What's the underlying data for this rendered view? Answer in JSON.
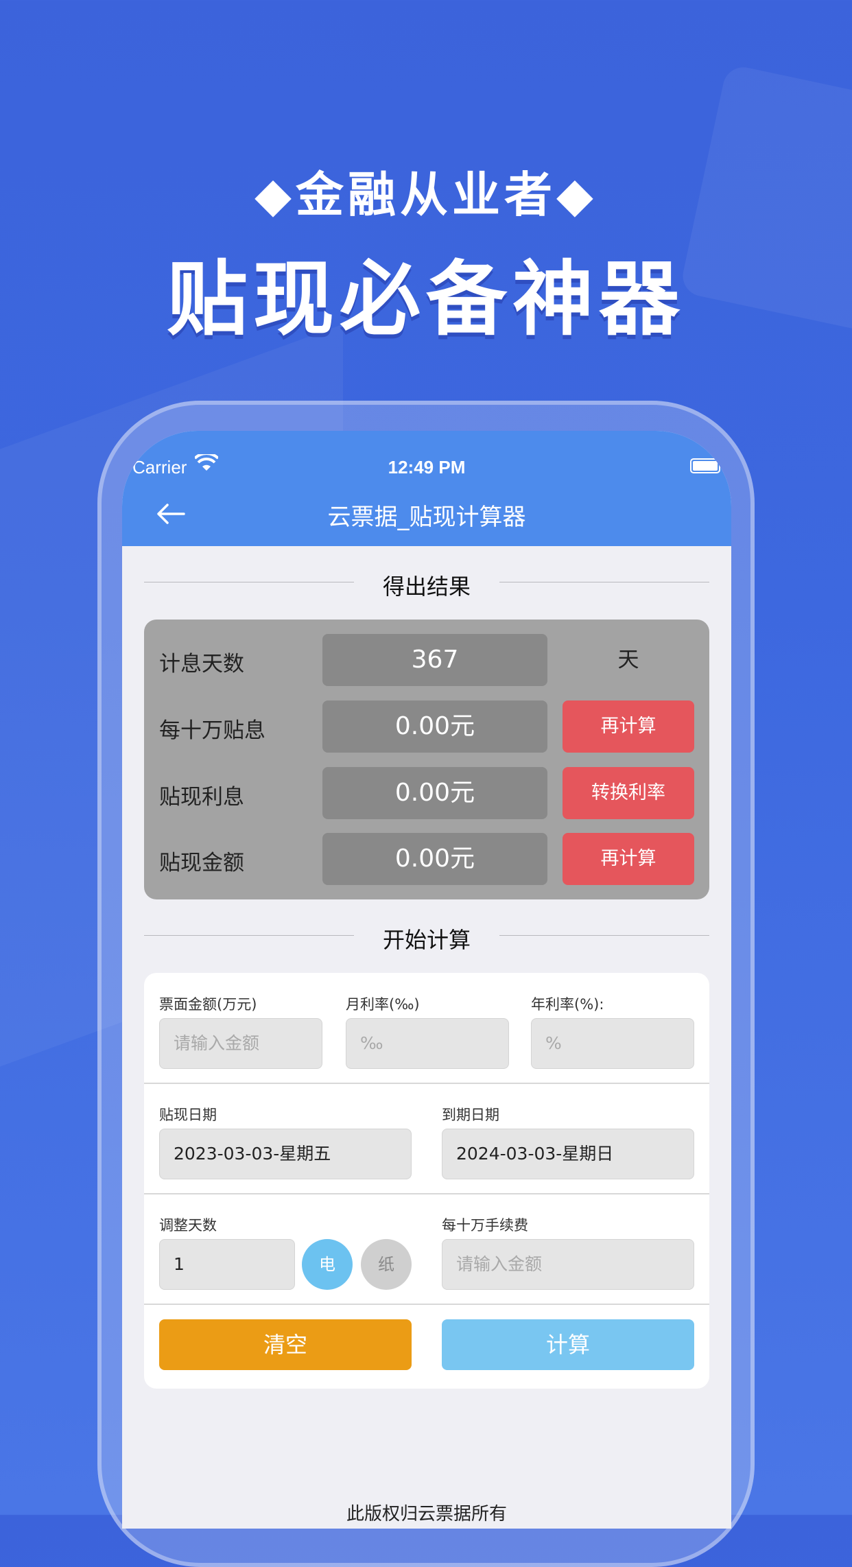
{
  "promo": {
    "subtitle": "◆金融从业者◆",
    "title": "贴现必备神器"
  },
  "status_bar": {
    "carrier": "Carrier",
    "time": "12:49 PM"
  },
  "nav": {
    "title": "云票据_贴现计算器"
  },
  "results": {
    "section_title": "得出结果",
    "rows": [
      {
        "label": "计息天数",
        "value": "367",
        "unit": "天"
      },
      {
        "label": "每十万贴息",
        "value": "0.00元",
        "button": "再计算"
      },
      {
        "label": "贴现利息",
        "value": "0.00元",
        "button": "转换利率"
      },
      {
        "label": "贴现金额",
        "value": "0.00元",
        "button": "再计算"
      }
    ]
  },
  "calc": {
    "section_title": "开始计算",
    "face_amount": {
      "label": "票面金额(万元)",
      "placeholder": "请输入金额"
    },
    "monthly_rate": {
      "label": "月利率(‰)",
      "placeholder": "‰"
    },
    "annual_rate": {
      "label": "年利率(%):",
      "placeholder": "%"
    },
    "discount_date": {
      "label": "贴现日期",
      "value": "2023-03-03-星期五"
    },
    "due_date": {
      "label": "到期日期",
      "value": "2024-03-03-星期日"
    },
    "adjust_days": {
      "label": "调整天数",
      "value": "1"
    },
    "toggle_electronic": "电",
    "toggle_paper": "纸",
    "fee": {
      "label": "每十万手续费",
      "placeholder": "请输入金额"
    },
    "clear_button": "清空",
    "calc_button": "计算"
  },
  "footer": {
    "copyright": "此版权归云票据所有"
  },
  "colors": {
    "accent": "#4d8bec",
    "red_button": "#e5565c",
    "orange_button": "#eb9c15",
    "light_blue_button": "#79c6f1",
    "toggle_active": "#6cc2f0",
    "toggle_inactive": "#cfcfcf"
  }
}
